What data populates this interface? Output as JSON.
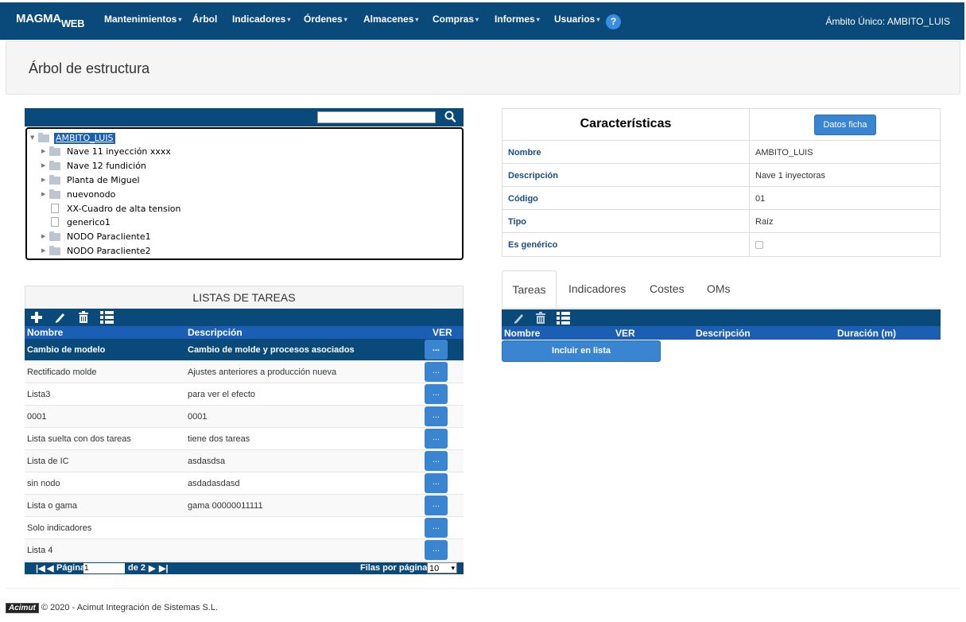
{
  "brand": {
    "main": "MAGMA",
    "sub": "WEB"
  },
  "nav": {
    "items": [
      {
        "label": "Mantenimientos",
        "caret": true
      },
      {
        "label": "Árbol",
        "caret": false
      },
      {
        "label": "Indicadores",
        "caret": true
      },
      {
        "label": "Órdenes",
        "caret": true
      },
      {
        "label": "Almacenes",
        "caret": true
      },
      {
        "label": "Compras",
        "caret": true
      },
      {
        "label": "Informes",
        "caret": true
      },
      {
        "label": "Usuarios",
        "caret": true
      }
    ],
    "help": "?",
    "scope": "Ámbito Único: AMBITO_LUIS"
  },
  "page": {
    "title": "Árbol de estructura"
  },
  "tree": {
    "search_value": "",
    "nodes": [
      {
        "label": "AMBITO_LUIS",
        "type": "folder",
        "expanded": true,
        "selected": true,
        "level": 0
      },
      {
        "label": "Nave 11 inyección xxxx",
        "type": "folder",
        "level": 1
      },
      {
        "label": "Nave 12 fundición",
        "type": "folder",
        "level": 1
      },
      {
        "label": "Planta de Miguel",
        "type": "folder",
        "level": 1
      },
      {
        "label": "nuevonodo",
        "type": "folder",
        "level": 1
      },
      {
        "label": "XX-Cuadro de alta tension",
        "type": "file",
        "level": 1
      },
      {
        "label": "generico1",
        "type": "file",
        "level": 1
      },
      {
        "label": "NODO Paracliente1",
        "type": "folder",
        "level": 1
      },
      {
        "label": "NODO Paracliente2",
        "type": "folder",
        "level": 1
      }
    ]
  },
  "tasks": {
    "title": "LISTAS DE TAREAS",
    "columns": {
      "name": "Nombre",
      "description": "Descripción",
      "view": "VER"
    },
    "view_button": "...",
    "rows": [
      {
        "name": "Cambio de modelo",
        "description": "Cambio de molde y procesos asociados"
      },
      {
        "name": "Rectificado molde",
        "description": "Ajustes anteriores a producción nueva"
      },
      {
        "name": "Lista3",
        "description": "para ver el efecto"
      },
      {
        "name": "0001",
        "description": "0001"
      },
      {
        "name": "Lista suelta con dos tareas",
        "description": "tiene dos tareas"
      },
      {
        "name": "Lista de IC",
        "description": "asdasdsa"
      },
      {
        "name": "sin nodo",
        "description": "asdadasdasd"
      },
      {
        "name": "Lista o gama",
        "description": "gama 00000011111"
      },
      {
        "name": "Solo indicadores",
        "description": ""
      },
      {
        "name": "Lista 4",
        "description": ""
      }
    ],
    "pager": {
      "page_label": "Página",
      "page_value": "1",
      "of_label": "de 2",
      "rows_label": "Filas por página:",
      "rows_value": "10"
    }
  },
  "characteristics": {
    "title": "Características",
    "button": "Datos ficha",
    "fields": [
      {
        "key": "Nombre",
        "value": "AMBITO_LUIS"
      },
      {
        "key": "Descripción",
        "value": "Nave 1 inyectoras"
      },
      {
        "key": "Código",
        "value": "01"
      },
      {
        "key": "Tipo",
        "value": "Raíz"
      },
      {
        "key": "Es genérico",
        "value": ""
      }
    ]
  },
  "tabs": {
    "items": [
      "Tareas",
      "Indicadores",
      "Costes",
      "OMs"
    ],
    "active": "Tareas"
  },
  "right_table": {
    "columns": [
      "Nombre",
      "VER",
      "Descripción",
      "Duración (m)"
    ],
    "include_button": "Incluir en lista"
  },
  "footer": {
    "logo": "Acimut",
    "text": "© 2020 - Acimut Integración de Sistemas S.L."
  },
  "colors": {
    "navbar": "#0a4a7a",
    "accent": "#1a5fb4",
    "button": "#3a85d1"
  }
}
